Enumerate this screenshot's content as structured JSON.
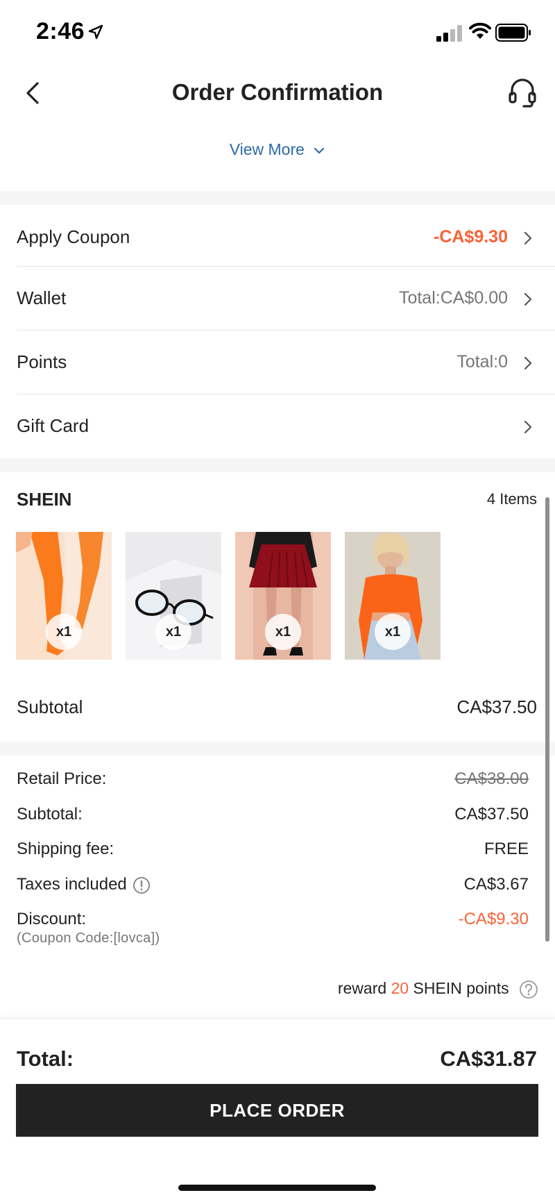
{
  "status_bar": {
    "time": "2:46"
  },
  "header": {
    "title": "Order Confirmation",
    "back_icon": "chevron-left-icon",
    "support_icon": "headset-icon"
  },
  "view_more": {
    "label": "View More"
  },
  "options": [
    {
      "label": "Apply Coupon",
      "value": "-CA$9.30"
    },
    {
      "label": "Wallet",
      "value": "Total:CA$0.00"
    },
    {
      "label": "Points",
      "value": "Total:0"
    },
    {
      "label": "Gift Card",
      "value": ""
    }
  ],
  "store": {
    "name": "SHEIN",
    "items_count": "4 Items",
    "items": [
      {
        "qty": "x1"
      },
      {
        "qty": "x1"
      },
      {
        "qty": "x1"
      },
      {
        "qty": "x1"
      }
    ],
    "subtotal_label": "Subtotal",
    "subtotal_value": "CA$37.50"
  },
  "price_details": {
    "retail_label": "Retail Price:",
    "retail_value": "CA$38.00",
    "subtotal_label": "Subtotal:",
    "subtotal_value": "CA$37.50",
    "shipping_label": "Shipping fee:",
    "shipping_value": "FREE",
    "taxes_label": "Taxes included",
    "taxes_value": "CA$3.67",
    "discount_label": "Discount:",
    "discount_value": "-CA$9.30",
    "coupon_code": "(Coupon Code:[lovca])"
  },
  "reward": {
    "prefix": "reward",
    "points": "20",
    "suffix": "SHEIN points"
  },
  "footer": {
    "total_label": "Total:",
    "total_value": "CA$31.87",
    "place_order_label": "PLACE ORDER"
  },
  "colors": {
    "accent": "#fa6338",
    "link": "#2d68a8",
    "button": "#222222"
  }
}
